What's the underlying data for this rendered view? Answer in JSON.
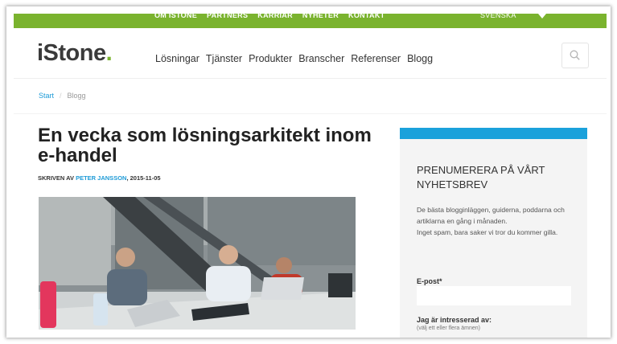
{
  "topbar": {
    "links": [
      "OM ISTONE",
      "PARTNERS",
      "KARRIÄR",
      "NYHETER",
      "KONTAKT"
    ],
    "language": "SVENSKA"
  },
  "header": {
    "logo_text": "iStone",
    "logo_dot": ".",
    "nav": [
      "Lösningar",
      "Tjänster",
      "Produkter",
      "Branscher",
      "Referenser",
      "Blogg"
    ]
  },
  "breadcrumb": {
    "home": "Start",
    "separator": "/",
    "current": "Blogg"
  },
  "article": {
    "title": "En vecka som lösningsarkitekt inom e-handel",
    "byline_prefix": "SKRIVEN AV ",
    "author": "PETER JANSSON",
    "date": ", 2015-11-05"
  },
  "newsletter": {
    "title": "PRENUMERERA PÅ VÅRT NYHETSBREV",
    "description": "De bästa blogginläggen, guiderna, poddarna och artiklarna en gång i månaden.",
    "description2": "Inget spam, bara saker vi tror du kommer gilla.",
    "email_label": "E-post*",
    "interest_label": "Jag är intresserad av:",
    "interest_hint": "(välj ett eller flera ämnen)"
  },
  "colors": {
    "brand_green": "#7ab32e",
    "accent_blue": "#1aa1db",
    "sidebar_bg": "#f4f4f4"
  }
}
